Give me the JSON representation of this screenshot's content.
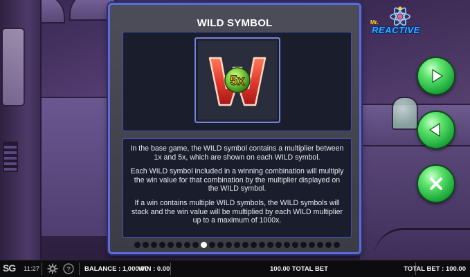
{
  "panel": {
    "title": "WILD SYMBOL",
    "symbol": {
      "letter": "W",
      "multiplier": "5x"
    },
    "paragraphs": [
      "In the base game, the WILD symbol contains a multiplier between 1x and 5x, which are shown on each WILD symbol.",
      "Each WILD symbol included in a winning combination will multiply the win value for that combination by the multiplier displayed on the WILD symbol.",
      "If a win contains multiple WILD symbols, the WILD symbols will stack and the win value will be multiplied by each WILD multiplier up to a maximum of 1000x."
    ],
    "pagination": {
      "total_pages": 25,
      "current_page": 9
    }
  },
  "logo": {
    "prefix": "Mr.",
    "name": "REACTIVE"
  },
  "buttons": {
    "next": {
      "icon": "play-arrow-icon"
    },
    "previous": {
      "icon": "back-arrow-icon"
    },
    "close": {
      "icon": "close-icon"
    }
  },
  "status_bar": {
    "brand": "SG",
    "time": "11:27",
    "balance": "BALANCE : 1,000.00",
    "win": "WIN : 0.00",
    "center_total": "100.00 TOTAL BET",
    "total_bet": "TOTAL BET : 100.00",
    "icons": [
      "gear-icon",
      "help-icon"
    ]
  },
  "colors": {
    "dialog_border": "#5d6bd6",
    "button_green": "#1faa3c",
    "wild_red": "#e23b2e",
    "multiplier_yellow": "#f5d33a"
  }
}
